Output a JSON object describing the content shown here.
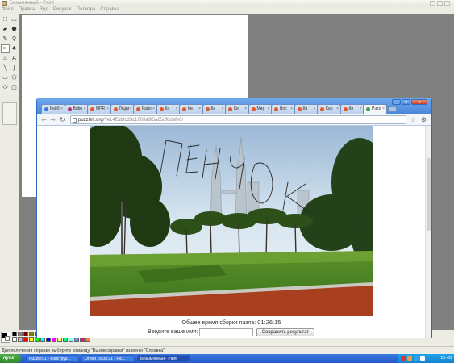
{
  "paint": {
    "title": "Безымянный - Paint",
    "menu": [
      "Файл",
      "Правка",
      "Вид",
      "Рисунок",
      "Палитра",
      "Справка"
    ],
    "status": "Для получения справки выберите команду \"Вызов справки\" из меню \"Справка\".",
    "palette_colors": [
      "#000000",
      "#808080",
      "#800000",
      "#808000",
      "#008000",
      "#008080",
      "#000080",
      "#800080",
      "#808040",
      "#004040",
      "#0080ff",
      "#004080",
      "#8000ff",
      "#804000",
      "#ffffff",
      "#c0c0c0",
      "#ff0000",
      "#ffff00",
      "#00ff00",
      "#00ffff",
      "#0000ff",
      "#ff00ff",
      "#ffff80",
      "#00ff80",
      "#80ffff",
      "#8080ff",
      "#ff0080",
      "#ff8040"
    ]
  },
  "browser": {
    "tabs": [
      {
        "label": "Рейб",
        "color": "#3a7bd5"
      },
      {
        "label": "Вubu",
        "color": "#c0307a"
      },
      {
        "label": "MPR",
        "color": "#e05a2a"
      },
      {
        "label": "Люди",
        "color": "#e05a2a"
      },
      {
        "label": "Райл",
        "color": "#e05a2a"
      },
      {
        "label": "Ка",
        "color": "#e05a2a"
      },
      {
        "label": "Ки",
        "color": "#e05a2a"
      },
      {
        "label": "Ки",
        "color": "#e05a2a"
      },
      {
        "label": "Ки",
        "color": "#e05a2a"
      },
      {
        "label": "Мир",
        "color": "#e05a2a"
      },
      {
        "label": "Вос",
        "color": "#e05a2a"
      },
      {
        "label": "Ки",
        "color": "#e05a2a"
      },
      {
        "label": "Кар",
        "color": "#e05a2a"
      },
      {
        "label": "Ки",
        "color": "#e05a2a"
      },
      {
        "label": "Puzzl",
        "color": "#3aa24a",
        "active": true
      }
    ],
    "url_host": "puzzlelt.org",
    "url_path": "/?e14f5d3cd3c1003a9f5a65df8dafe6/"
  },
  "page": {
    "photo_caption": "ПЕНЧУК",
    "time_label": "Общее время сборки пазла:",
    "time_value": "01:26:15",
    "name_label": "Введите ваше имя:",
    "name_value": "",
    "save_label": "Сохранить результат"
  },
  "taskbar": {
    "start_label": "пуск",
    "items": [
      {
        "label": "Puzzle.01 - Конструк...",
        "active": false
      },
      {
        "label": "Огней 16:05:21 - Pic...",
        "active": false
      },
      {
        "label": "Безымянный - Paint",
        "active": true
      }
    ],
    "clock": "15:43"
  }
}
